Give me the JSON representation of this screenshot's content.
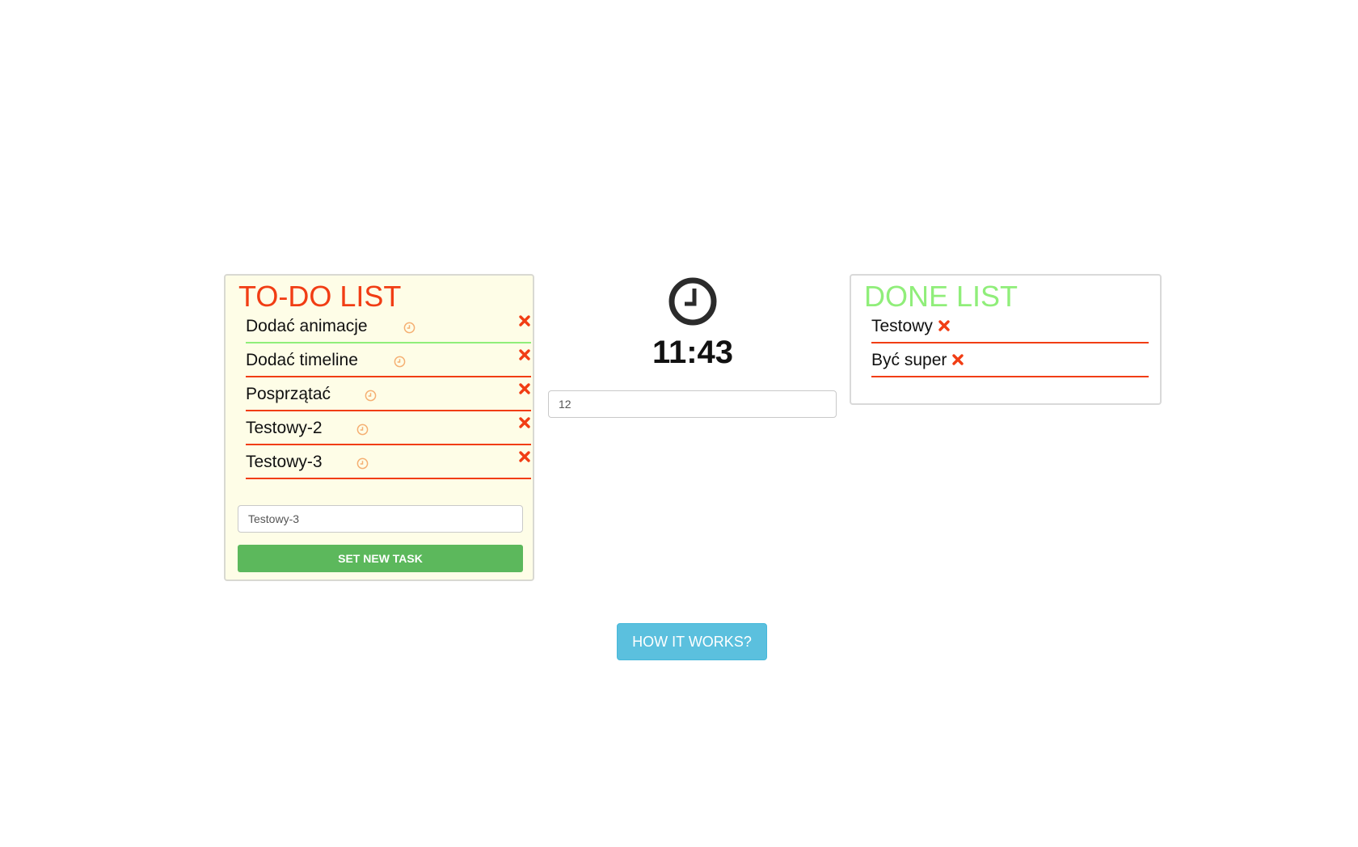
{
  "colors": {
    "todo_title": "#f13d14",
    "done_title": "#90ee7a",
    "remove_icon": "#f13d14",
    "task_clock": "#f5b073",
    "primary_button": "#5cb85c",
    "info_button": "#5bc0de",
    "todo_background": "#fefde7"
  },
  "todo": {
    "title": "TO-DO LIST",
    "tasks": [
      {
        "label": "Dodać animacje",
        "icon": "clock-icon",
        "remove_icon": "close-icon"
      },
      {
        "label": "Dodać timeline",
        "icon": "clock-icon",
        "remove_icon": "close-icon"
      },
      {
        "label": "Posprzątać",
        "icon": "clock-icon",
        "remove_icon": "close-icon"
      },
      {
        "label": "Testowy-2",
        "icon": "clock-icon",
        "remove_icon": "close-icon"
      },
      {
        "label": "Testowy-3",
        "icon": "clock-icon",
        "remove_icon": "close-icon"
      }
    ],
    "input_value": "Testowy-3",
    "submit_label": "SET NEW TASK"
  },
  "timer": {
    "icon": "clock-icon",
    "time": "11:43",
    "minutes_value": "12"
  },
  "done": {
    "title": "DONE LIST",
    "tasks": [
      {
        "label": "Testowy",
        "remove_icon": "close-icon"
      },
      {
        "label": "Być super",
        "remove_icon": "close-icon"
      }
    ]
  },
  "help": {
    "button_label": "HOW IT WORKS?"
  }
}
